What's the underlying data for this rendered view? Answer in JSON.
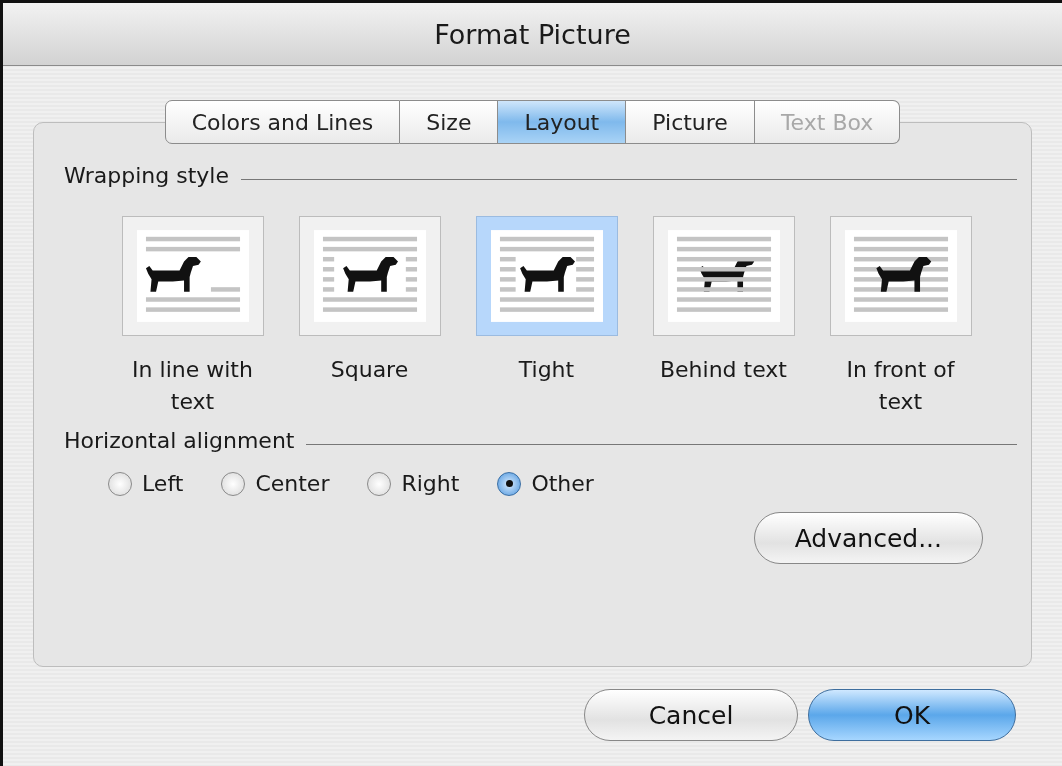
{
  "window": {
    "title": "Format Picture"
  },
  "tabs": [
    {
      "label": "Colors and Lines",
      "selected": false,
      "disabled": false
    },
    {
      "label": "Size",
      "selected": false,
      "disabled": false
    },
    {
      "label": "Layout",
      "selected": true,
      "disabled": false
    },
    {
      "label": "Picture",
      "selected": false,
      "disabled": false
    },
    {
      "label": "Text Box",
      "selected": false,
      "disabled": true
    }
  ],
  "wrapping_style": {
    "label": "Wrapping style",
    "options": [
      {
        "kind": "inline",
        "label": "In line with text",
        "selected": false
      },
      {
        "kind": "square",
        "label": "Square",
        "selected": false
      },
      {
        "kind": "tight",
        "label": "Tight",
        "selected": true
      },
      {
        "kind": "behind",
        "label": "Behind text",
        "selected": false
      },
      {
        "kind": "front",
        "label": "In front of text",
        "selected": false
      }
    ]
  },
  "horizontal_alignment": {
    "label": "Horizontal alignment",
    "options": [
      {
        "label": "Left",
        "selected": false
      },
      {
        "label": "Center",
        "selected": false
      },
      {
        "label": "Right",
        "selected": false
      },
      {
        "label": "Other",
        "selected": true
      }
    ]
  },
  "advanced_button": "Advanced...",
  "buttons": [
    {
      "label": "Cancel",
      "kind": "normal"
    },
    {
      "label": "OK",
      "kind": "default"
    }
  ]
}
